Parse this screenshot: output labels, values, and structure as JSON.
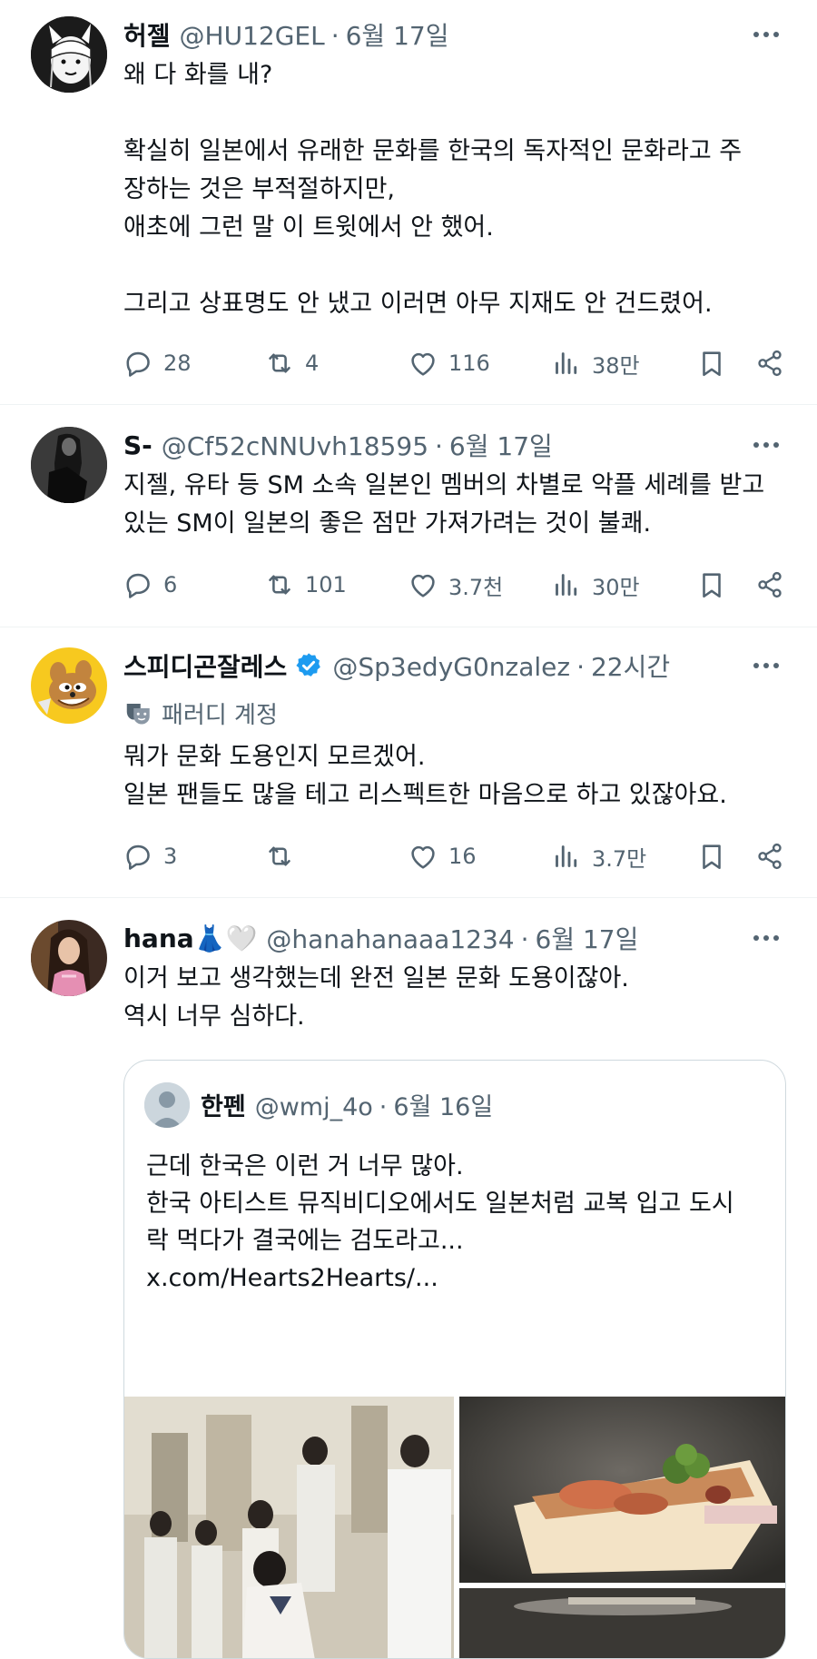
{
  "tweets": [
    {
      "name": "허젤",
      "handle": "@HU12GEL",
      "date": "6월 17일",
      "text": "왜 다 화를 내?\n\n확실히 일본에서 유래한 문화를 한국의 독자적인 문화라고 주\n장하는 것은 부적절하지만,\n애초에 그런 말 이 트윗에서 안 했어.\n\n그리고 상표명도 안 냈고 이러면 아무 지재도 안 건드렸어.",
      "replies": "28",
      "retweets": "4",
      "likes": "116",
      "views": "38만"
    },
    {
      "name": "S-",
      "handle": "@Cf52cNNUvh18595",
      "date": "6월 17일",
      "text": "지젤, 유타 등 SM 소속 일본인 멤버의 차별로 악플 세례를 받고\n있는 SM이 일본의 좋은 점만 가져가려는 것이 불쾌.",
      "replies": "6",
      "retweets": "101",
      "likes": "3.7천",
      "views": "30만"
    },
    {
      "name": "스피디곤잘레스",
      "handle": "@Sp3edyG0nzalez",
      "date": "22시간",
      "label": "패러디 계정",
      "text": "뭐가 문화 도용인지 모르겠어.\n일본 팬들도 많을 테고 리스펙트한 마음으로 하고 있잖아요.",
      "replies": "3",
      "retweets": "",
      "likes": "16",
      "views": "3.7만"
    },
    {
      "name": "hana👗🤍",
      "handle": "@hanahanaaa1234",
      "date": "6월 17일",
      "text": "이거 보고 생각했는데 완전 일본 문화 도용이잖아.\n역시 너무 심하다.",
      "quote": {
        "name": "한펜",
        "handle": "@wmj_4o",
        "date": "6월 16일",
        "text": "  근데 한국은 이런 거 너무 많아.\n한국 아티스트 뮤직비디오에서도 일본처럼 교복 입고 도시\n락 먹다가 결국에는 검도라고...\nx.com/Hearts2Hearts/..."
      }
    }
  ],
  "separator": "·",
  "icons": {
    "reply": "reply-icon",
    "retweet": "retweet-icon",
    "like": "heart-icon",
    "views": "views-icon",
    "bookmark": "bookmark-icon",
    "share": "share-icon",
    "more": "more-icon",
    "verified": "verified-badge-icon",
    "parody": "parody-mask-icon"
  },
  "colors": {
    "text": "#0f1419",
    "secondary": "#536471",
    "border": "#eff3f4",
    "verified": "#1d9bf0"
  }
}
